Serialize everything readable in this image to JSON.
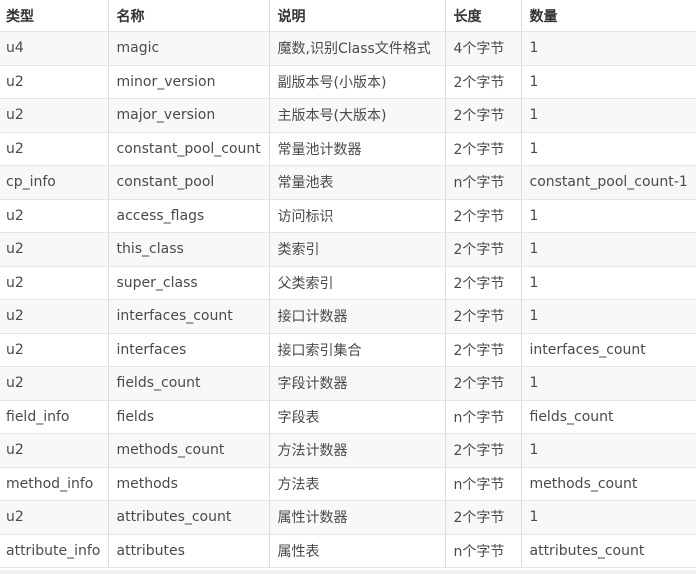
{
  "table": {
    "headers": [
      "类型",
      "名称",
      "说明",
      "长度",
      "数量"
    ],
    "rows": [
      [
        "u4",
        "magic",
        "魔数,识别Class文件格式",
        "4个字节",
        "1"
      ],
      [
        "u2",
        "minor_version",
        "副版本号(小版本)",
        "2个字节",
        "1"
      ],
      [
        "u2",
        "major_version",
        "主版本号(大版本)",
        "2个字节",
        "1"
      ],
      [
        "u2",
        "constant_pool_count",
        "常量池计数器",
        "2个字节",
        "1"
      ],
      [
        "cp_info",
        "constant_pool",
        "常量池表",
        "n个字节",
        "constant_pool_count-1"
      ],
      [
        "u2",
        "access_flags",
        "访问标识",
        "2个字节",
        "1"
      ],
      [
        "u2",
        "this_class",
        "类索引",
        "2个字节",
        "1"
      ],
      [
        "u2",
        "super_class",
        "父类索引",
        "2个字节",
        "1"
      ],
      [
        "u2",
        "interfaces_count",
        "接口计数器",
        "2个字节",
        "1"
      ],
      [
        "u2",
        "interfaces",
        "接口索引集合",
        "2个字节",
        "interfaces_count"
      ],
      [
        "u2",
        "fields_count",
        "字段计数器",
        "2个字节",
        "1"
      ],
      [
        "field_info",
        "fields",
        "字段表",
        "n个字节",
        "fields_count"
      ],
      [
        "u2",
        "methods_count",
        "方法计数器",
        "2个字节",
        "1"
      ],
      [
        "method_info",
        "methods",
        "方法表",
        "n个字节",
        "methods_count"
      ],
      [
        "u2",
        "attributes_count",
        "属性计数器",
        "2个字节",
        "1"
      ],
      [
        "attribute_info",
        "attributes",
        "属性表",
        "n个字节",
        "attributes_count"
      ]
    ]
  }
}
